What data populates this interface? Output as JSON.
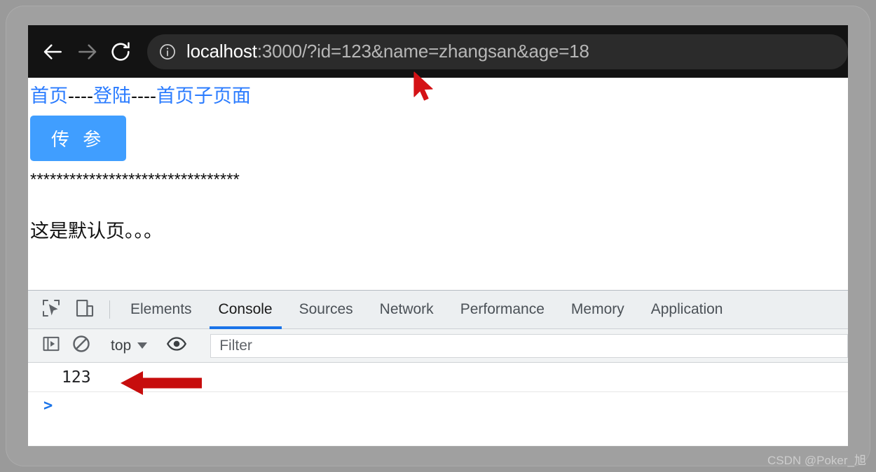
{
  "browser": {
    "back_label": "Back",
    "forward_label": "Forward",
    "reload_label": "Reload",
    "site_info_label": "View site information",
    "url_host": "localhost",
    "url_rest": ":3000/?id=123&name=zhangsan&age=18",
    "url_full": "localhost:3000/?id=123&name=zhangsan&age=18"
  },
  "page": {
    "links": [
      {
        "label": "首页"
      },
      {
        "label": "登陆"
      },
      {
        "label": "首页子页面"
      }
    ],
    "separator": "----",
    "button_label": "传 参",
    "stars": "********************************",
    "body_text": "这是默认页。。。"
  },
  "devtools": {
    "inspect_icon_label": "Inspect element",
    "device_toolbar_icon_label": "Toggle device toolbar",
    "tabs": [
      {
        "label": "Elements",
        "active": false
      },
      {
        "label": "Console",
        "active": true
      },
      {
        "label": "Sources",
        "active": false
      },
      {
        "label": "Network",
        "active": false
      },
      {
        "label": "Performance",
        "active": false
      },
      {
        "label": "Memory",
        "active": false
      },
      {
        "label": "Application",
        "active": false
      }
    ],
    "toolbar": {
      "sidebar_toggle_label": "Show console sidebar",
      "clear_label": "Clear console",
      "context_value": "top",
      "eye_label": "Create live expression",
      "filter_placeholder": "Filter",
      "filter_value": ""
    },
    "console": {
      "messages": [
        {
          "text": "123"
        }
      ],
      "prompt": ">"
    }
  },
  "annotations": {
    "cursor_color": "#d41216",
    "arrow_color": "#c70d0d",
    "accent_blue": "#1a73e8",
    "button_blue": "#409eff",
    "link_blue": "#2b7cff"
  },
  "watermark": {
    "text": "CSDN @Poker_旭"
  }
}
